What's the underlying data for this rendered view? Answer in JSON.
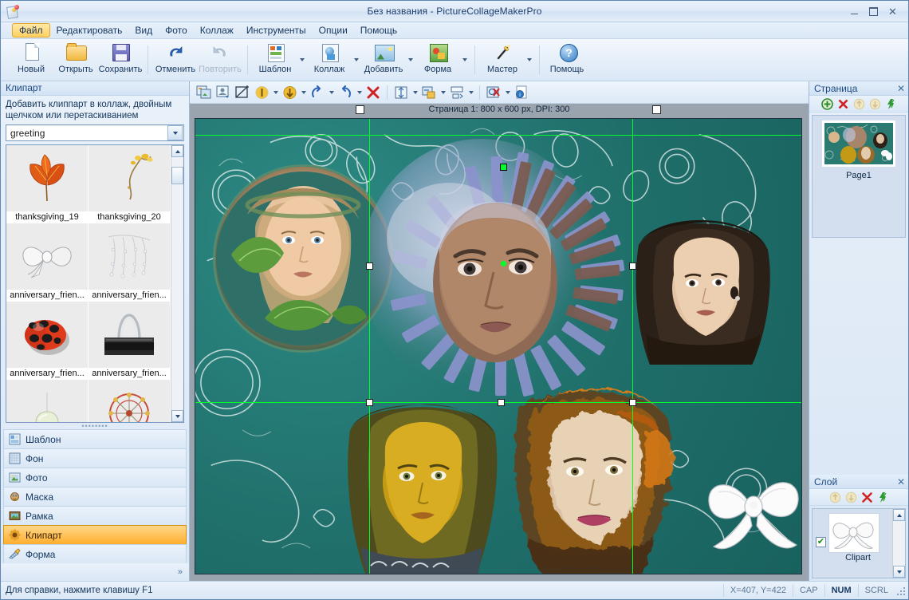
{
  "window": {
    "title": "Без названия - PictureCollageMakerPro",
    "app_icon": "collage-app-icon",
    "minimize": "–",
    "maximize": "□",
    "close": "✕"
  },
  "menubar": {
    "items": [
      {
        "label": "Файл",
        "accel": "Ф",
        "active": true
      },
      {
        "label": "Редактировать",
        "accel": "Р",
        "active": false
      },
      {
        "label": "Вид",
        "accel": "В",
        "active": false
      },
      {
        "label": "Фото",
        "accel": "Ф",
        "active": false
      },
      {
        "label": "Коллаж",
        "accel": "К",
        "active": false
      },
      {
        "label": "Инструменты",
        "accel": "И",
        "active": false
      },
      {
        "label": "Опции",
        "accel": "О",
        "active": false
      },
      {
        "label": "Помощь",
        "accel": "П",
        "active": false
      }
    ]
  },
  "toolbar": {
    "buttons": [
      {
        "label": "Новый",
        "icon": "new-document-icon",
        "dropdown": false,
        "disabled": false
      },
      {
        "label": "Открыть",
        "icon": "open-folder-icon",
        "dropdown": false,
        "disabled": false
      },
      {
        "label": "Сохранить",
        "icon": "save-floppy-icon",
        "dropdown": false,
        "disabled": false
      },
      {
        "label": "Отменить",
        "icon": "undo-arrow-icon",
        "dropdown": false,
        "disabled": false
      },
      {
        "label": "Повторить",
        "icon": "redo-arrow-icon",
        "dropdown": false,
        "disabled": true
      },
      {
        "label": "Шаблон",
        "icon": "template-icon",
        "dropdown": true,
        "disabled": false
      },
      {
        "label": "Коллаж",
        "icon": "collage-icon",
        "dropdown": true,
        "disabled": false
      },
      {
        "label": "Добавить",
        "icon": "add-photo-icon",
        "dropdown": true,
        "disabled": false
      },
      {
        "label": "Форма",
        "icon": "shape-icon",
        "dropdown": true,
        "disabled": false
      },
      {
        "label": "Мастер",
        "icon": "wizard-wand-icon",
        "dropdown": true,
        "disabled": false
      },
      {
        "label": "Помощь",
        "icon": "help-circle-icon",
        "dropdown": false,
        "disabled": false
      }
    ]
  },
  "canvas_toolbar": {
    "buttons": [
      {
        "icon": "swap-photo-icon",
        "dropdown": false
      },
      {
        "icon": "replace-photo-icon",
        "dropdown": false
      },
      {
        "icon": "crop-photo-icon",
        "dropdown": false
      },
      {
        "icon": "bring-forward-icon",
        "dropdown": true
      },
      {
        "icon": "send-backward-icon",
        "dropdown": true
      },
      {
        "icon": "rotate-right-icon",
        "dropdown": true
      },
      {
        "icon": "rotate-left-icon",
        "dropdown": true
      },
      {
        "icon": "delete-red-x-icon",
        "dropdown": false
      },
      {
        "icon": "align-vertical-icon",
        "dropdown": true
      },
      {
        "icon": "align-left-icon",
        "dropdown": true
      },
      {
        "icon": "distribute-icon",
        "dropdown": true
      },
      {
        "icon": "clear-search-icon",
        "dropdown": true
      },
      {
        "icon": "info-page-icon",
        "dropdown": false
      }
    ]
  },
  "page_info": {
    "text": "Страница 1: 800 x 600 px, DPI: 300",
    "handle_left": "resize-handle-left",
    "handle_right": "resize-handle-right"
  },
  "left_panel": {
    "title": "Клипарт",
    "hint": "Добавить клиппарт в коллаж, двойным щелчком или перетаскиванием",
    "category_combo": {
      "value": "greeting",
      "placeholder": "greeting"
    },
    "clipart_items": [
      {
        "name": "thanksgiving_19",
        "icon": "autumn-leaf-clipart"
      },
      {
        "name": "thanksgiving_20",
        "icon": "branch-clipart"
      },
      {
        "name": "anniversary_frien...",
        "icon": "white-bow-clipart"
      },
      {
        "name": "anniversary_frien...",
        "icon": "pearl-strand-clipart"
      },
      {
        "name": "anniversary_frien...",
        "icon": "ladybug-clipart"
      },
      {
        "name": "anniversary_frien...",
        "icon": "binder-clip-clipart"
      },
      {
        "name": "",
        "icon": "balloon-clipart"
      },
      {
        "name": "",
        "icon": "ferris-wheel-clipart"
      }
    ],
    "categories": [
      {
        "label": "Шаблон",
        "icon": "template-list-icon",
        "selected": false
      },
      {
        "label": "Фон",
        "icon": "background-grid-icon",
        "selected": false
      },
      {
        "label": "Фото",
        "icon": "photo-frame-icon",
        "selected": false
      },
      {
        "label": "Маска",
        "icon": "mask-icon",
        "selected": false
      },
      {
        "label": "Рамка",
        "icon": "frame-icon",
        "selected": false
      },
      {
        "label": "Клипарт",
        "icon": "clipart-icon",
        "selected": true
      },
      {
        "label": "Форма",
        "icon": "shape-ruler-icon",
        "selected": false
      }
    ],
    "expand_chevron": "»"
  },
  "right_panel": {
    "page_section": {
      "title": "Страница",
      "close": "✕",
      "tools": [
        {
          "icon": "add-page-icon",
          "enabled": true
        },
        {
          "icon": "delete-page-icon",
          "enabled": true
        },
        {
          "icon": "move-page-up-icon",
          "enabled": false
        },
        {
          "icon": "move-page-down-icon",
          "enabled": false
        },
        {
          "icon": "refresh-page-icon",
          "enabled": true
        }
      ],
      "page_thumb_label": "Page1"
    },
    "layer_section": {
      "title": "Слой",
      "close": "✕",
      "tools": [
        {
          "icon": "layer-up-icon",
          "enabled": false
        },
        {
          "icon": "layer-down-icon",
          "enabled": false
        },
        {
          "icon": "delete-layer-icon",
          "enabled": true
        },
        {
          "icon": "refresh-layer-icon",
          "enabled": true
        }
      ],
      "layers": [
        {
          "name": "Clipart",
          "icon": "white-bow-clipart",
          "visible": true,
          "checkmark": "✔"
        }
      ],
      "scroll_up": "▲",
      "scroll_down": "▼"
    }
  },
  "statusbar": {
    "hint": "Для справки, нажмите клавишу F1",
    "coordinates": "X=407, Y=422",
    "indicators": [
      {
        "label": "CAP",
        "active": false
      },
      {
        "label": "NUM",
        "active": true
      },
      {
        "label": "SCRL",
        "active": false
      }
    ]
  },
  "colors": {
    "canvas_bg": "#1f6e6a",
    "guide": "#00ff2a",
    "selection_accent": "#ffae2e",
    "title_text": "#1f3f6b",
    "chrome": "#dce8f6"
  }
}
